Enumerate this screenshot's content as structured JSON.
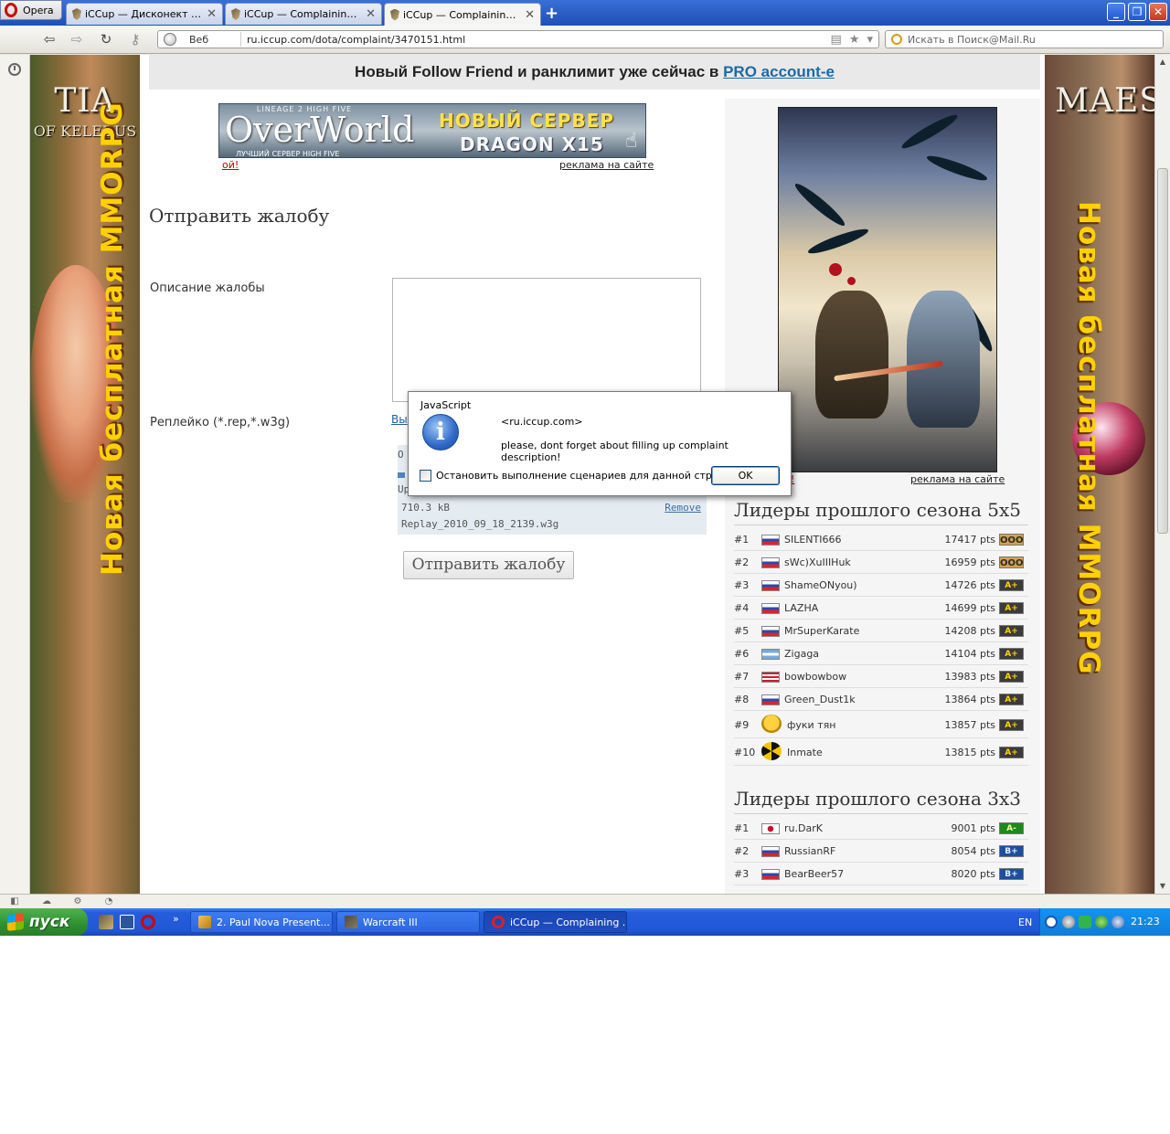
{
  "browser": {
    "menu_label": "Opera",
    "tabs": [
      {
        "title": "iCCup — Дисконект из ..."
      },
      {
        "title": "iCCup — Complaining ab..."
      },
      {
        "title": "iCCup — Complaining ab..."
      }
    ],
    "address": {
      "web_label": "Веб",
      "url": "ru.iccup.com/dota/complaint/3470151.html"
    },
    "search_placeholder": "Искать в Поиск@Mail.Ru"
  },
  "page": {
    "promo": {
      "text": "Новый Follow Friend и ранклимит уже сейчас в ",
      "link": "PRO account-e"
    },
    "left_banner": {
      "logo": "TIA",
      "subtitle": "OF KELEDUS",
      "vertical": "Новая бесплатная MMORPG"
    },
    "right_banner": {
      "logo": "MAES",
      "vertical": "Новая бесплатная MMORPG"
    },
    "top_ad": {
      "small": "LINEAGE 2 HIGH FIVE",
      "brand": "OverWorld",
      "tagline": "ЛУЧШИЙ СЕРВЕР HIGH FIVE",
      "headline": "НОВЫЙ СЕРВЕР",
      "server": "DRAGON X15",
      "oops": "ой!",
      "site_ads": "реклама на сайте"
    },
    "form": {
      "title": "Отправить жалобу",
      "desc_label": "Описание жалобы",
      "replay_label": "Реплейко (*.rep,*.w3g)",
      "choose_link": "Вы",
      "upload": {
        "line1": "О",
        "line2": "Up",
        "size": "710.3 kB",
        "remove": "Remove",
        "filename": "Replay_2010_09_18_2139.w3g",
        "progress": 1.0
      },
      "submit": "Отправить жалобу"
    },
    "side_ad": {
      "oops": "ой!",
      "site_ads": "реклама на сайте"
    },
    "leaders_5x5": {
      "title": "Лидеры прошлого сезона 5х5",
      "rows": [
        {
          "rank": "#1",
          "name": "SILENTI666",
          "pts": "17417 pts",
          "badge": "OOO",
          "flag": "ru"
        },
        {
          "rank": "#2",
          "name": "sWc)XuIIIHuk",
          "pts": "16959 pts",
          "badge": "OOO",
          "flag": "ru"
        },
        {
          "rank": "#3",
          "name": "ShameONyou)",
          "pts": "14726 pts",
          "badge": "A+",
          "flag": "ru"
        },
        {
          "rank": "#4",
          "name": "LAZHA",
          "pts": "14699 pts",
          "badge": "A+",
          "flag": "ru"
        },
        {
          "rank": "#5",
          "name": "MrSuperKarate",
          "pts": "14208 pts",
          "badge": "A+",
          "flag": "ru"
        },
        {
          "rank": "#6",
          "name": "Zigaga",
          "pts": "14104 pts",
          "badge": "A+",
          "flag": "ar"
        },
        {
          "rank": "#7",
          "name": "bowbowbow",
          "pts": "13983 pts",
          "badge": "A+",
          "flag": "us"
        },
        {
          "rank": "#8",
          "name": "Green_Dust1k",
          "pts": "13864 pts",
          "badge": "A+",
          "flag": "ru"
        },
        {
          "rank": "#9",
          "name": "фуки тян",
          "pts": "13857 pts",
          "badge": "A+",
          "flag": "smiley"
        },
        {
          "rank": "#10",
          "name": "Inmate",
          "pts": "13815 pts",
          "badge": "A+",
          "flag": "radiation"
        }
      ]
    },
    "leaders_3x3": {
      "title": "Лидеры прошлого сезона 3х3",
      "rows": [
        {
          "rank": "#1",
          "name": "ru.DarK",
          "pts": "9001 pts",
          "badge": "A-",
          "flag": "jp"
        },
        {
          "rank": "#2",
          "name": "RussianRF",
          "pts": "8054 pts",
          "badge": "B+",
          "flag": "ru"
        },
        {
          "rank": "#3",
          "name": "BearBeer57",
          "pts": "8020 pts",
          "badge": "B+",
          "flag": "ru"
        }
      ]
    }
  },
  "dialog": {
    "caption": "JavaScript",
    "origin": "<ru.iccup.com>",
    "message": "please, dont forget about filling up complaint description!",
    "checkbox_label": "Остановить выполнение сценариев для данной страницы",
    "checkbox_checked": false,
    "ok": "OK"
  },
  "taskbar": {
    "start": "пуск",
    "buttons": [
      {
        "label": "2. Paul Nova Present..."
      },
      {
        "label": "Warcraft III"
      },
      {
        "label": "iCCup — Complaining ..."
      }
    ],
    "language": "EN",
    "time": "21:23"
  },
  "colors": {
    "link": "#1a6aa8",
    "oops": "#c00000",
    "banner_text": "#ffd100",
    "taskbar": "#245edb",
    "start_button": "#2f8f2f"
  }
}
